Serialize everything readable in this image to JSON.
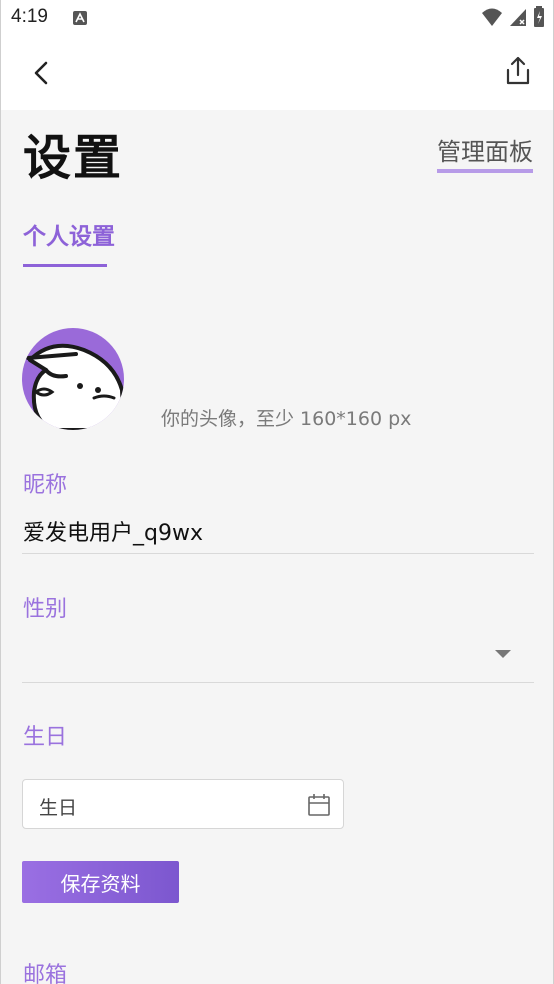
{
  "status_bar": {
    "time": "4:19"
  },
  "page": {
    "title": "设置",
    "admin_link": "管理面板",
    "tab_label": "个人设置"
  },
  "avatar": {
    "hint": "你的头像，至少 160*160 px"
  },
  "fields": {
    "nickname": {
      "label": "昵称",
      "value": "爱发电用户_q9wx"
    },
    "gender": {
      "label": "性别",
      "value": ""
    },
    "birthday": {
      "label": "生日",
      "placeholder": "生日"
    },
    "email": {
      "label": "邮箱"
    }
  },
  "buttons": {
    "save_label": "保存资料"
  },
  "colors": {
    "accent": "#8d62d8",
    "label": "#9a72de",
    "avatar_bg": "#9a6ad9"
  },
  "icons": [
    "back-arrow-icon",
    "share-icon",
    "calendar-icon",
    "dropdown-arrow-icon",
    "wifi-icon",
    "signal-icon",
    "battery-icon"
  ]
}
